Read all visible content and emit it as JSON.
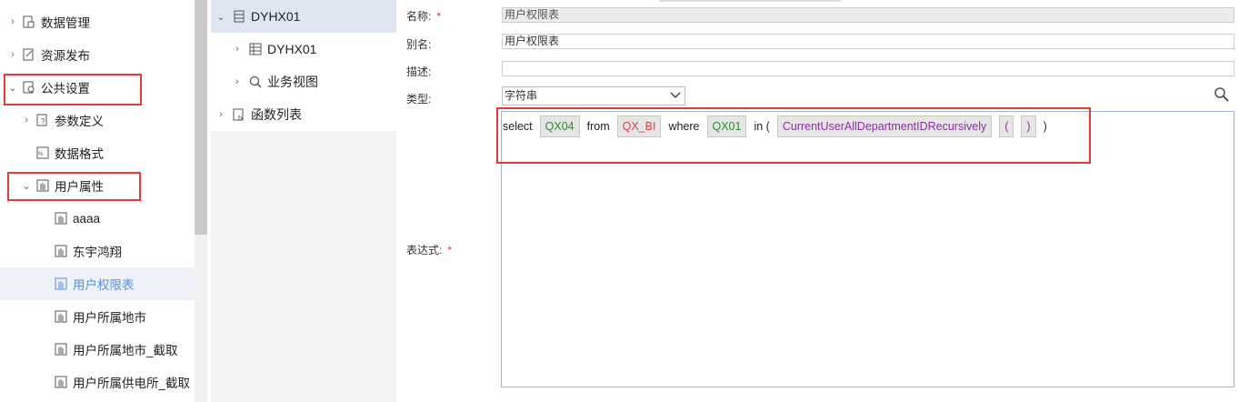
{
  "nav": {
    "items": [
      {
        "label": "数据管理",
        "chevron": "›",
        "level": 0
      },
      {
        "label": "资源发布",
        "chevron": "›",
        "level": 0
      },
      {
        "label": "公共设置",
        "chevron": "⌄",
        "level": 0
      },
      {
        "label": "参数定义",
        "chevron": "›",
        "level": 1
      },
      {
        "label": "数据格式",
        "chevron": "",
        "level": 1
      },
      {
        "label": "用户属性",
        "chevron": "⌄",
        "level": 1
      },
      {
        "label": "aaaa",
        "chevron": "",
        "level": 2
      },
      {
        "label": "东宇鸿翔",
        "chevron": "",
        "level": 2
      },
      {
        "label": "用户权限表",
        "chevron": "",
        "level": 2
      },
      {
        "label": "用户所属地市",
        "chevron": "",
        "level": 2
      },
      {
        "label": "用户所属地市_截取",
        "chevron": "",
        "level": 2
      },
      {
        "label": "用户所属供电所_截取",
        "chevron": "",
        "level": 2
      }
    ]
  },
  "mid": {
    "items": [
      {
        "label": "DYHX01",
        "chevron": "⌄"
      },
      {
        "label": "DYHX01",
        "chevron": "›"
      },
      {
        "label": "业务视图",
        "chevron": "›"
      },
      {
        "label": "函数列表",
        "chevron": "›"
      }
    ]
  },
  "form": {
    "name_label": "名称:",
    "name_required": "*",
    "name_value": "用户权限表",
    "alias_label": "别名:",
    "alias_value": "用户权限表",
    "desc_label": "描述:",
    "desc_value": "",
    "type_label": "类型:",
    "type_value": "字符串",
    "expr_label": "表达式:",
    "expr_required": "*"
  },
  "expression": {
    "kw_select": "select",
    "tok_qx04": "QX04",
    "kw_from": "from",
    "tok_qxbi": "QX_BI",
    "kw_where": "where",
    "tok_qx01": "QX01",
    "kw_in": "in (",
    "tok_func": "CurrentUserAllDepartmentIDRecursively",
    "tok_lparen": "(",
    "tok_rparen": ")",
    "close_paren": ")"
  },
  "colors": {
    "highlight": "#e53935",
    "selected_text": "#5b8fd8",
    "token_green": "#2e8b2e",
    "token_red": "#e04040",
    "token_purple": "#8a2fa0"
  }
}
